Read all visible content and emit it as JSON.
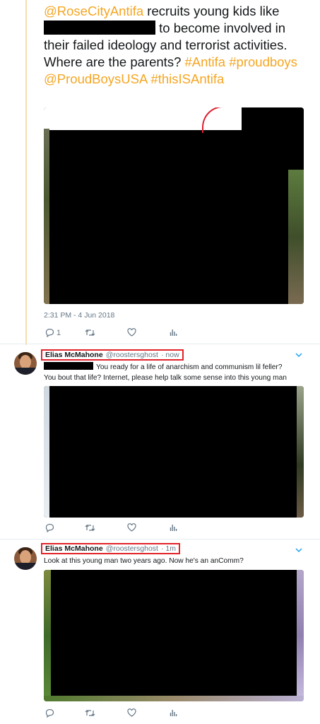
{
  "tweet": {
    "mention": "@RoseCityAntifa",
    "text_1": " recruits young kids like ",
    "text_2": " to become involved in their failed ideology and terrorist activities.  Where are the parents? ",
    "hashtag_antifa": "#Antifa",
    "hashtag_proudboys": "#proudboys",
    "mention_proudboys": "@ProudBoysUSA",
    "hashtag_thisisantifa": "#thisISAntifa",
    "timestamp": "2:31 PM - 4 Jun 2018",
    "reply_count": "1"
  },
  "replies": [
    {
      "name": "Elias McMahone",
      "handle": "@roostersghost",
      "time": "· now",
      "text_line1": "You ready for a life of anarchism and communism lil feller?",
      "text_line2": "You bout that life?  Internet, please help talk some sense into this young man"
    },
    {
      "name": "Elias McMahone",
      "handle": "@roostersghost",
      "time": "· 1m",
      "text_line1": "Look at this young man two years ago.  Now he's an anComm?"
    }
  ],
  "icons": [
    "reply-icon",
    "retweet-icon",
    "like-icon",
    "analytics-icon",
    "chevron-down-icon"
  ],
  "colors": {
    "highlight": "#f5a623",
    "redbox": "#e0242a",
    "muted": "#657786"
  }
}
